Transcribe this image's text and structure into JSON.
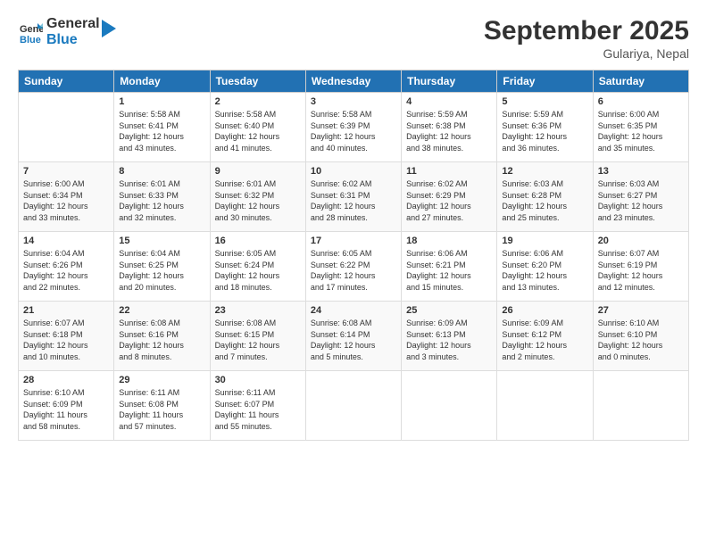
{
  "header": {
    "logo_line1": "General",
    "logo_line2": "Blue",
    "title": "September 2025",
    "location": "Gulariya, Nepal"
  },
  "weekdays": [
    "Sunday",
    "Monday",
    "Tuesday",
    "Wednesday",
    "Thursday",
    "Friday",
    "Saturday"
  ],
  "weeks": [
    [
      {
        "day": "",
        "text": ""
      },
      {
        "day": "1",
        "text": "Sunrise: 5:58 AM\nSunset: 6:41 PM\nDaylight: 12 hours\nand 43 minutes."
      },
      {
        "day": "2",
        "text": "Sunrise: 5:58 AM\nSunset: 6:40 PM\nDaylight: 12 hours\nand 41 minutes."
      },
      {
        "day": "3",
        "text": "Sunrise: 5:58 AM\nSunset: 6:39 PM\nDaylight: 12 hours\nand 40 minutes."
      },
      {
        "day": "4",
        "text": "Sunrise: 5:59 AM\nSunset: 6:38 PM\nDaylight: 12 hours\nand 38 minutes."
      },
      {
        "day": "5",
        "text": "Sunrise: 5:59 AM\nSunset: 6:36 PM\nDaylight: 12 hours\nand 36 minutes."
      },
      {
        "day": "6",
        "text": "Sunrise: 6:00 AM\nSunset: 6:35 PM\nDaylight: 12 hours\nand 35 minutes."
      }
    ],
    [
      {
        "day": "7",
        "text": "Sunrise: 6:00 AM\nSunset: 6:34 PM\nDaylight: 12 hours\nand 33 minutes."
      },
      {
        "day": "8",
        "text": "Sunrise: 6:01 AM\nSunset: 6:33 PM\nDaylight: 12 hours\nand 32 minutes."
      },
      {
        "day": "9",
        "text": "Sunrise: 6:01 AM\nSunset: 6:32 PM\nDaylight: 12 hours\nand 30 minutes."
      },
      {
        "day": "10",
        "text": "Sunrise: 6:02 AM\nSunset: 6:31 PM\nDaylight: 12 hours\nand 28 minutes."
      },
      {
        "day": "11",
        "text": "Sunrise: 6:02 AM\nSunset: 6:29 PM\nDaylight: 12 hours\nand 27 minutes."
      },
      {
        "day": "12",
        "text": "Sunrise: 6:03 AM\nSunset: 6:28 PM\nDaylight: 12 hours\nand 25 minutes."
      },
      {
        "day": "13",
        "text": "Sunrise: 6:03 AM\nSunset: 6:27 PM\nDaylight: 12 hours\nand 23 minutes."
      }
    ],
    [
      {
        "day": "14",
        "text": "Sunrise: 6:04 AM\nSunset: 6:26 PM\nDaylight: 12 hours\nand 22 minutes."
      },
      {
        "day": "15",
        "text": "Sunrise: 6:04 AM\nSunset: 6:25 PM\nDaylight: 12 hours\nand 20 minutes."
      },
      {
        "day": "16",
        "text": "Sunrise: 6:05 AM\nSunset: 6:24 PM\nDaylight: 12 hours\nand 18 minutes."
      },
      {
        "day": "17",
        "text": "Sunrise: 6:05 AM\nSunset: 6:22 PM\nDaylight: 12 hours\nand 17 minutes."
      },
      {
        "day": "18",
        "text": "Sunrise: 6:06 AM\nSunset: 6:21 PM\nDaylight: 12 hours\nand 15 minutes."
      },
      {
        "day": "19",
        "text": "Sunrise: 6:06 AM\nSunset: 6:20 PM\nDaylight: 12 hours\nand 13 minutes."
      },
      {
        "day": "20",
        "text": "Sunrise: 6:07 AM\nSunset: 6:19 PM\nDaylight: 12 hours\nand 12 minutes."
      }
    ],
    [
      {
        "day": "21",
        "text": "Sunrise: 6:07 AM\nSunset: 6:18 PM\nDaylight: 12 hours\nand 10 minutes."
      },
      {
        "day": "22",
        "text": "Sunrise: 6:08 AM\nSunset: 6:16 PM\nDaylight: 12 hours\nand 8 minutes."
      },
      {
        "day": "23",
        "text": "Sunrise: 6:08 AM\nSunset: 6:15 PM\nDaylight: 12 hours\nand 7 minutes."
      },
      {
        "day": "24",
        "text": "Sunrise: 6:08 AM\nSunset: 6:14 PM\nDaylight: 12 hours\nand 5 minutes."
      },
      {
        "day": "25",
        "text": "Sunrise: 6:09 AM\nSunset: 6:13 PM\nDaylight: 12 hours\nand 3 minutes."
      },
      {
        "day": "26",
        "text": "Sunrise: 6:09 AM\nSunset: 6:12 PM\nDaylight: 12 hours\nand 2 minutes."
      },
      {
        "day": "27",
        "text": "Sunrise: 6:10 AM\nSunset: 6:10 PM\nDaylight: 12 hours\nand 0 minutes."
      }
    ],
    [
      {
        "day": "28",
        "text": "Sunrise: 6:10 AM\nSunset: 6:09 PM\nDaylight: 11 hours\nand 58 minutes."
      },
      {
        "day": "29",
        "text": "Sunrise: 6:11 AM\nSunset: 6:08 PM\nDaylight: 11 hours\nand 57 minutes."
      },
      {
        "day": "30",
        "text": "Sunrise: 6:11 AM\nSunset: 6:07 PM\nDaylight: 11 hours\nand 55 minutes."
      },
      {
        "day": "",
        "text": ""
      },
      {
        "day": "",
        "text": ""
      },
      {
        "day": "",
        "text": ""
      },
      {
        "day": "",
        "text": ""
      }
    ]
  ]
}
